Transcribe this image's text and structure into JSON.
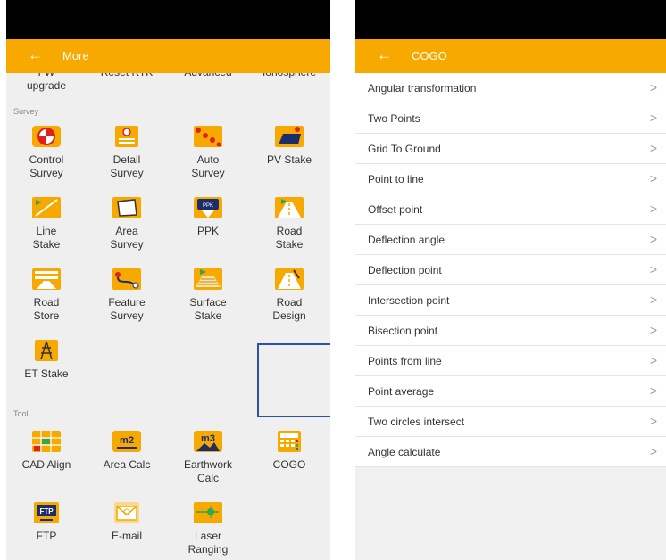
{
  "left": {
    "header": {
      "back_icon": "←",
      "title": "More"
    },
    "top_row": [
      "FW\nupgrade",
      "Reset RTK",
      "Advanced",
      "Ionosphere"
    ],
    "sections": [
      {
        "label": "Survey",
        "items": [
          {
            "label": "Control\nSurvey",
            "icon": "control-survey-icon"
          },
          {
            "label": "Detail\nSurvey",
            "icon": "detail-survey-icon"
          },
          {
            "label": "Auto\nSurvey",
            "icon": "auto-survey-icon"
          },
          {
            "label": "PV Stake",
            "icon": "pv-stake-icon"
          },
          {
            "label": "Line\nStake",
            "icon": "line-stake-icon"
          },
          {
            "label": "Area\nSurvey",
            "icon": "area-survey-icon"
          },
          {
            "label": "PPK",
            "icon": "ppk-icon"
          },
          {
            "label": "Road\nStake",
            "icon": "road-stake-icon"
          },
          {
            "label": "Road\nStore",
            "icon": "road-store-icon"
          },
          {
            "label": "Feature\nSurvey",
            "icon": "feature-survey-icon"
          },
          {
            "label": "Surface\nStake",
            "icon": "surface-stake-icon"
          },
          {
            "label": "Road\nDesign",
            "icon": "road-design-icon"
          },
          {
            "label": "ET Stake",
            "icon": "et-stake-icon"
          }
        ]
      },
      {
        "label": "Tool",
        "items": [
          {
            "label": "CAD Align",
            "icon": "cad-align-icon"
          },
          {
            "label": "Area Calc",
            "icon": "area-calc-icon",
            "icon_text": "m2"
          },
          {
            "label": "Earthwork\nCalc",
            "icon": "earthwork-calc-icon",
            "icon_text": "m3"
          },
          {
            "label": "COGO",
            "icon": "cogo-icon"
          },
          {
            "label": "FTP",
            "icon": "ftp-icon",
            "icon_text": "FTP"
          },
          {
            "label": "E-mail",
            "icon": "email-icon"
          },
          {
            "label": "Laser\nRanging",
            "icon": "laser-ranging-icon"
          }
        ]
      }
    ],
    "icon_text_ppk": "PPK"
  },
  "right": {
    "header": {
      "back_icon": "←",
      "title": "COGO"
    },
    "items": [
      "Angular transformation",
      "Two Points",
      "Grid To Ground",
      "Point to line",
      "Offset point",
      "Deflection angle",
      "Deflection point",
      "Intersection point",
      "Bisection point",
      "Points from line",
      "Point average",
      "Two circles intersect",
      "Angle calculate"
    ],
    "chevron": ">"
  },
  "colors": {
    "accent": "#f7a900",
    "highlight_border": "#2d52a8"
  }
}
